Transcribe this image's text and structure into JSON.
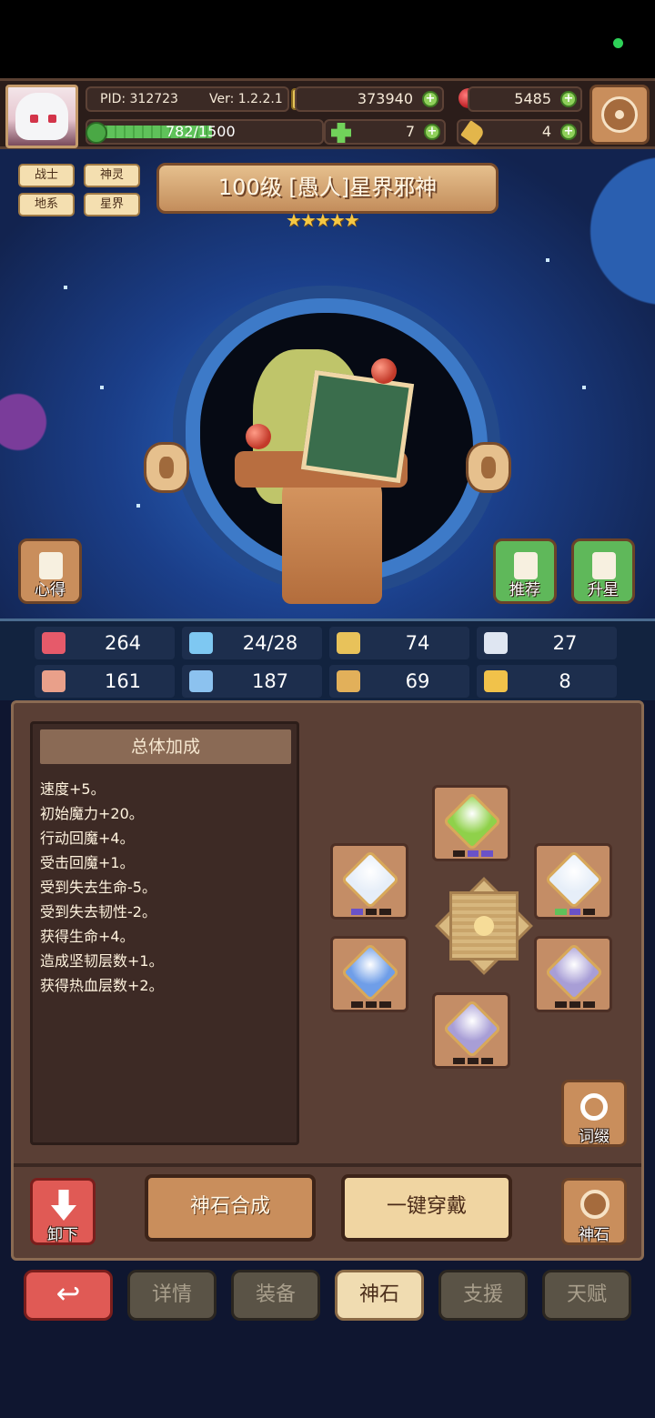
{
  "header": {
    "pid": "PID: 312723",
    "version": "Ver: 1.2.2.1",
    "gold": "373940",
    "gems": "5485",
    "xp": "782/1500",
    "xp_ratio": 0.52,
    "clover": "7",
    "pickaxe": "4"
  },
  "hero": {
    "tags": [
      "战士",
      "神灵",
      "地系",
      "星界"
    ],
    "title": "100级  [愚人]星界邪神",
    "stars": "★★★★★",
    "star_count": 5
  },
  "scene_buttons": {
    "insight": "心得",
    "recommend": "推荐",
    "ascend": "升星"
  },
  "stats": [
    {
      "icon": "heart-icon",
      "value": "264",
      "color": "#e65a6a"
    },
    {
      "icon": "water-drop-icon",
      "value": "24/28",
      "color": "#7ec8f2"
    },
    {
      "icon": "shield-icon",
      "value": "74",
      "color": "#e8c25a"
    },
    {
      "icon": "wing-icon",
      "value": "27",
      "color": "#dfe6f2"
    },
    {
      "icon": "fist-icon",
      "value": "161",
      "color": "#e9a08a"
    },
    {
      "icon": "book-icon",
      "value": "187",
      "color": "#8cc2ef"
    },
    {
      "icon": "scroll-icon",
      "value": "69",
      "color": "#e2b05a"
    },
    {
      "icon": "horseshoe-icon",
      "value": "8",
      "color": "#f1c24a"
    }
  ],
  "bonus": {
    "title": "总体加成",
    "lines": [
      "速度+5。",
      "初始魔力+20。",
      "行动回魔+4。",
      "受击回魔+1。",
      "受到失去生命-5。",
      "受到失去韧性-2。",
      "获得生命+4。",
      "造成坚韧层数+1。",
      "获得热血层数+2。"
    ]
  },
  "gem_slots": {
    "top": {
      "gem": "green-gem",
      "color": "#8fd14a"
    },
    "left_upper": {
      "gem": "white-gem",
      "color": "#e6eef8"
    },
    "right_upper": {
      "gem": "white-gem",
      "color": "#e6eef8"
    },
    "left_lower": {
      "gem": "blue-gem",
      "color": "#6f9ee8"
    },
    "right_lower": {
      "gem": "purple-gem",
      "color": "#a89ed6"
    },
    "bottom": {
      "gem": "purple-gem",
      "color": "#a89ed6"
    }
  },
  "actions": {
    "unequip": "卸下",
    "synthesize": "神石合成",
    "equip_all": "一键穿戴",
    "affix": "词缀",
    "godstone": "神石"
  },
  "nav": {
    "tabs": [
      "详情",
      "装备",
      "神石",
      "支援",
      "天赋"
    ],
    "active": "神石"
  }
}
